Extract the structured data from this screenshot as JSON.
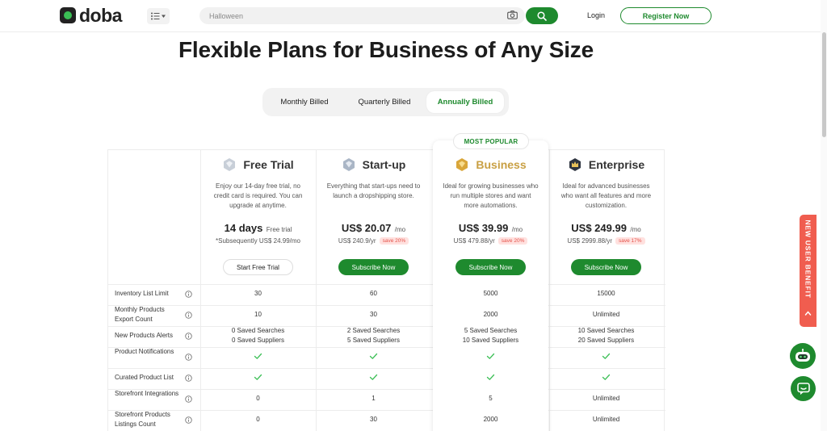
{
  "header": {
    "logo_text": "doba",
    "search_placeholder": "Halloween",
    "login_label": "Login",
    "register_label": "Register Now"
  },
  "hero": {
    "title": "Flexible Plans for Business of Any Size"
  },
  "billing": {
    "options": [
      "Monthly Billed",
      "Quarterly Billed",
      "Annually Billed"
    ],
    "selected": "Annually Billed"
  },
  "plans": [
    {
      "name": "Free Trial",
      "description": "Enjoy our 14-day free trial, no credit card is required. You can upgrade at anytime.",
      "price": "14 days",
      "price_unit": "Free trial",
      "sub_price": "*Subsequently US$ 24.99/mo",
      "save": "",
      "button": "Start Free Trial"
    },
    {
      "name": "Start-up",
      "description": "Everything that start-ups need to launch a dropshipping store.",
      "price": "US$ 20.07",
      "price_unit": "/mo",
      "sub_price": "US$ 240.9/yr",
      "save": "save 20%",
      "button": "Subscribe Now"
    },
    {
      "name": "Business",
      "description": "Ideal for growing businesses who run multiple stores and want more automations.",
      "price": "US$ 39.99",
      "price_unit": "/mo",
      "sub_price": "US$ 479.88/yr",
      "save": "save 20%",
      "button": "Subscribe Now",
      "badge": "MOST POPULAR"
    },
    {
      "name": "Enterprise",
      "description": "Ideal for advanced businesses who want all features and more customization.",
      "price": "US$ 249.99",
      "price_unit": "/mo",
      "sub_price": "US$ 2999.88/yr",
      "save": "save 17%",
      "button": "Subscribe Now"
    }
  ],
  "features": [
    {
      "label": "Inventory List Limit",
      "values": [
        "30",
        "60",
        "5000",
        "15000"
      ]
    },
    {
      "label": "Monthly Products Export Count",
      "values": [
        "10",
        "30",
        "2000",
        "Unlimited"
      ]
    },
    {
      "label": "New Products Alerts",
      "values": [
        "0 Saved Searches\n0 Saved Suppliers",
        "2 Saved Searches\n5 Saved Suppliers",
        "5 Saved Searches\n10 Saved Suppliers",
        "10 Saved Searches\n20 Saved Suppliers"
      ]
    },
    {
      "label": "Product Notifications",
      "values": [
        "check",
        "check",
        "check",
        "check"
      ]
    },
    {
      "label": "Curated Product List",
      "values": [
        "check",
        "check",
        "check",
        "check"
      ]
    },
    {
      "label": "Storefront Integrations",
      "values": [
        "0",
        "1",
        "5",
        "Unlimited"
      ]
    },
    {
      "label": "Storefront Products Listings Count",
      "values": [
        "0",
        "30",
        "2000",
        "Unlimited"
      ]
    }
  ],
  "side": {
    "benefit_label": "NEW USER BENEFIT"
  },
  "colors": {
    "brand_green": "#1e8a2e",
    "check_green": "#3bbf55",
    "business_gold": "#c9a044",
    "save_red": "#e5534b",
    "benefit_red": "#f05d4f"
  },
  "icons": [
    "menu-icon",
    "camera-icon",
    "search-icon",
    "gem-icon",
    "crown-icon",
    "info-icon",
    "check-icon",
    "chevron-up-icon",
    "robot-icon",
    "chat-icon"
  ]
}
